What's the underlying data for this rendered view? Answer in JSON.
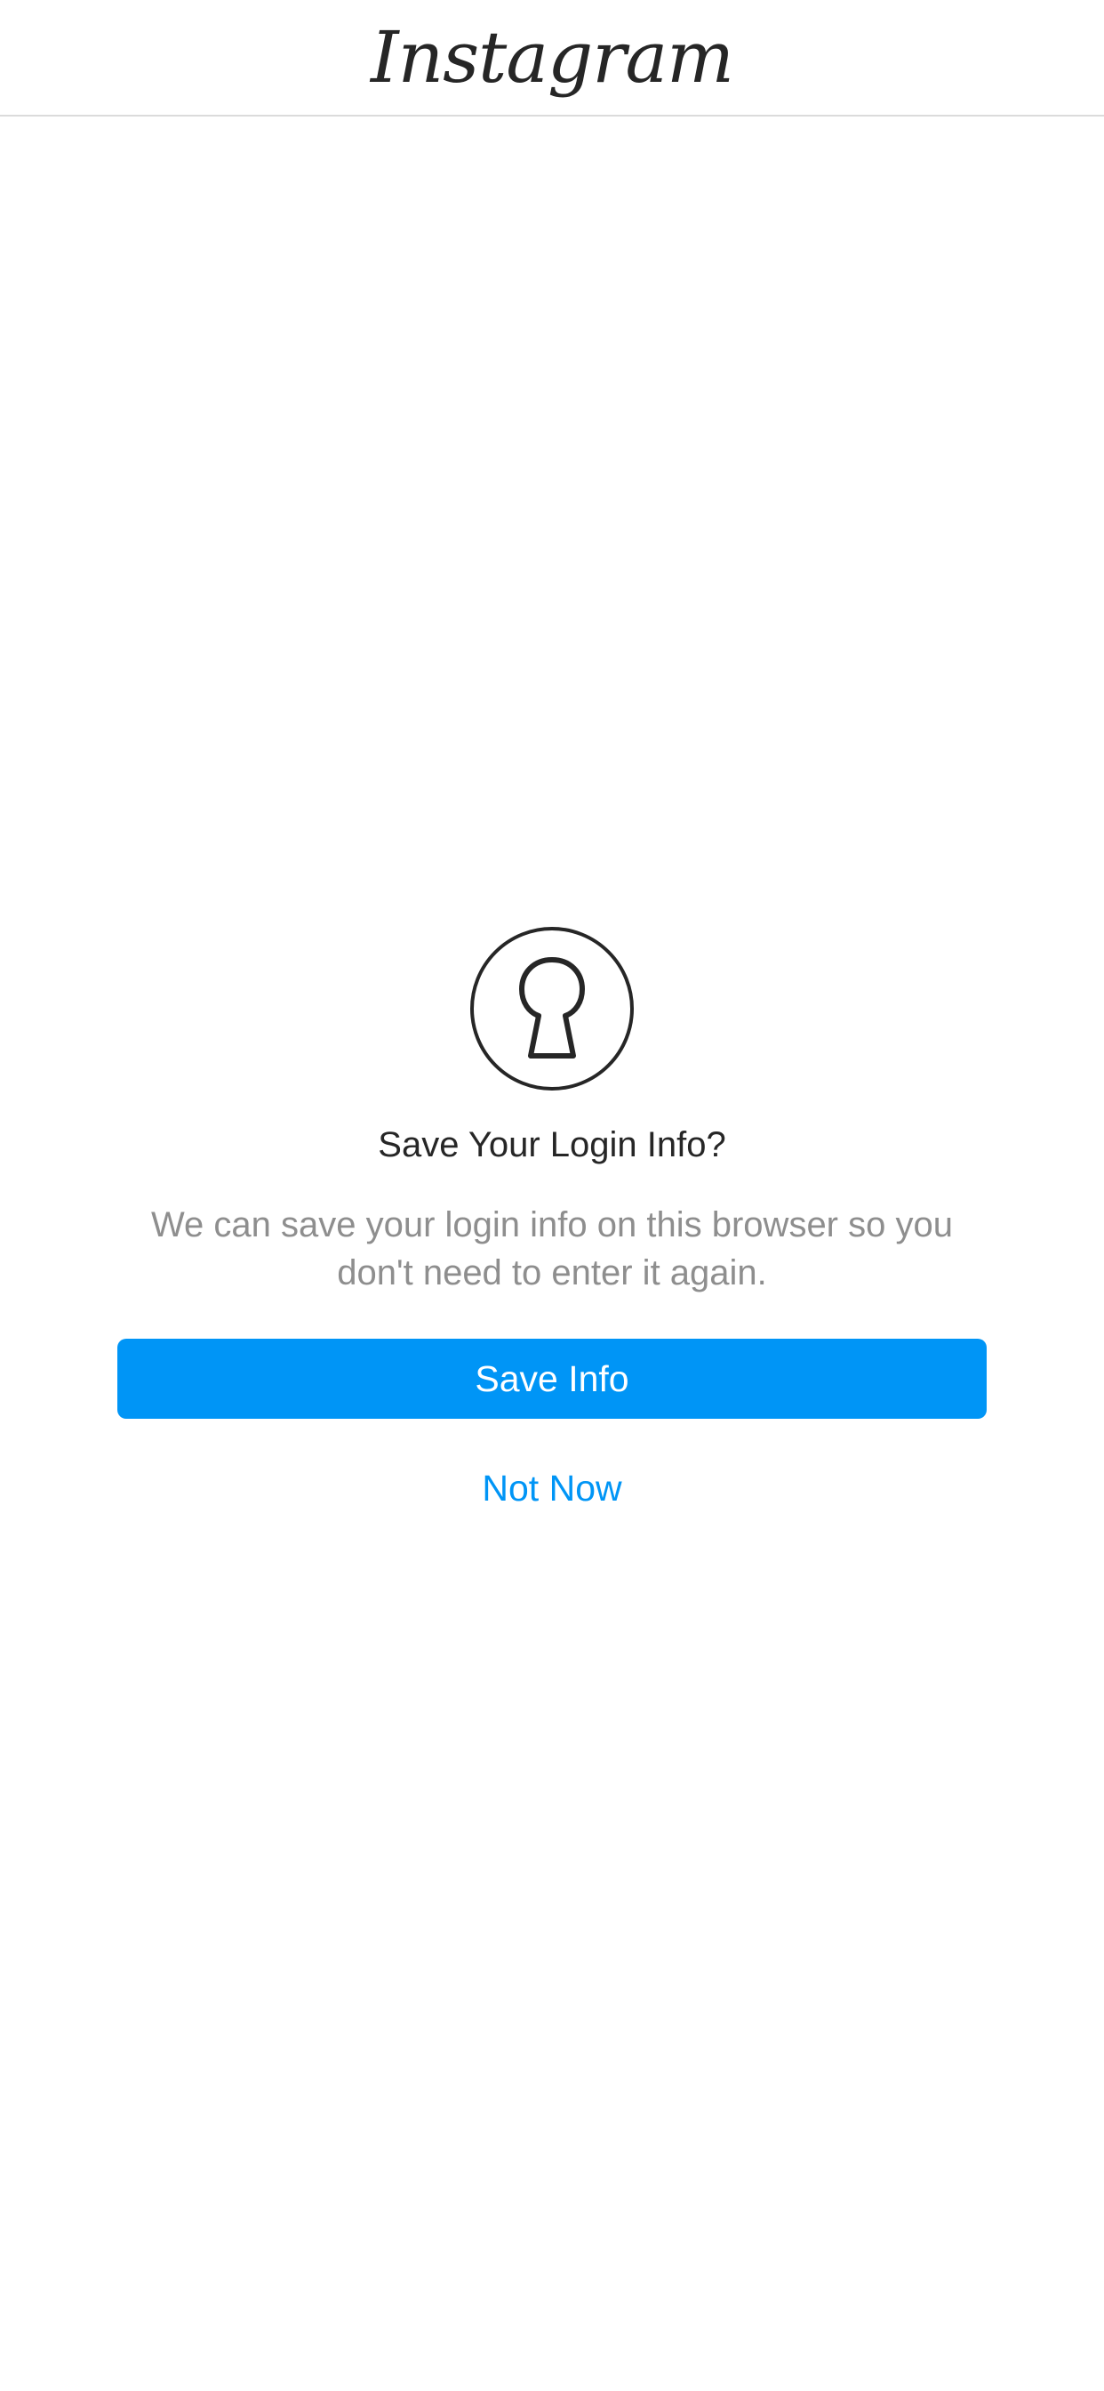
{
  "header": {
    "logo_text": "Instagram"
  },
  "dialog": {
    "icon": "keyhole-lock-icon",
    "title": "Save Your Login Info?",
    "description": "We can save your login info on this browser so you don't need to enter it again.",
    "primary_button": "Save Info",
    "secondary_button": "Not Now"
  },
  "colors": {
    "accent": "#0095f6",
    "title_text": "#262626",
    "secondary_text": "#8e8e8e",
    "divider": "#dbdbdb",
    "background": "#ffffff"
  }
}
